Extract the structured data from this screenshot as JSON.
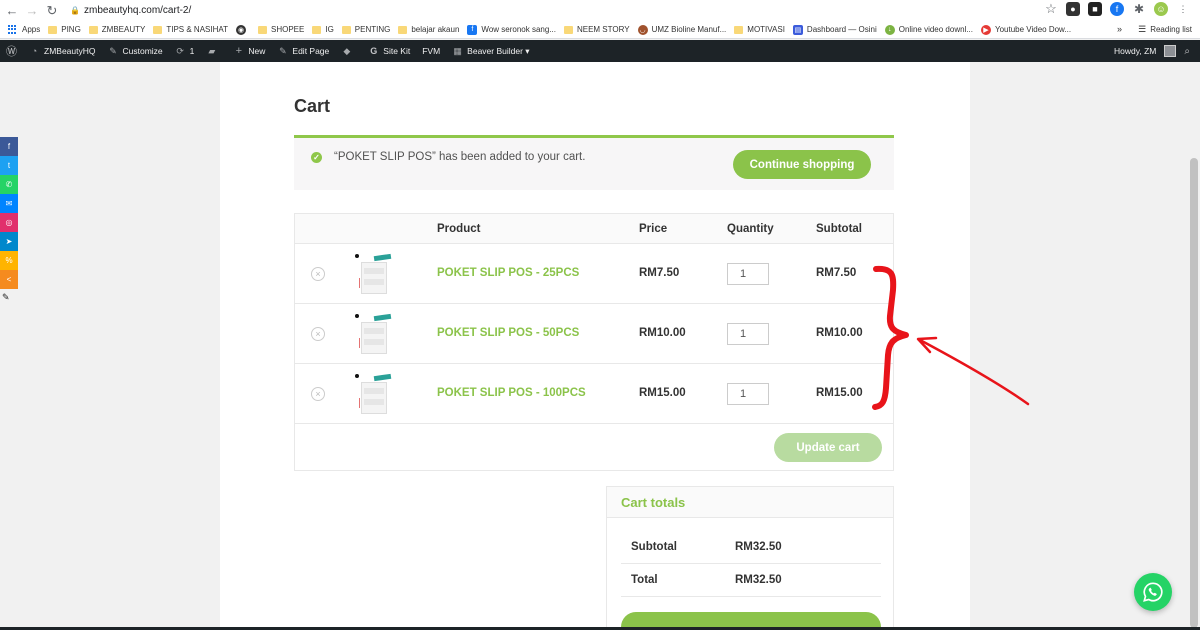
{
  "browser": {
    "url": "zmbeautyhq.com/cart-2/",
    "bookmarks": [
      {
        "label": "Apps",
        "kind": "apps"
      },
      {
        "label": "PING",
        "kind": "folder"
      },
      {
        "label": "ZMBEAUTY",
        "kind": "folder"
      },
      {
        "label": "TIPS & NASIHAT",
        "kind": "folder"
      },
      {
        "label": "",
        "kind": "globe"
      },
      {
        "label": "SHOPEE",
        "kind": "folder"
      },
      {
        "label": "IG",
        "kind": "folder"
      },
      {
        "label": "PENTING",
        "kind": "folder"
      },
      {
        "label": "belajar akaun",
        "kind": "folder"
      },
      {
        "label": "Wow seronok sang...",
        "kind": "facebook"
      },
      {
        "label": "NEEM STORY",
        "kind": "folder"
      },
      {
        "label": "UMZ Bioline Manuf...",
        "kind": "site"
      },
      {
        "label": "MOTIVASI",
        "kind": "folder"
      },
      {
        "label": "Dashboard — Osini",
        "kind": "dash"
      },
      {
        "label": "Online video downl...",
        "kind": "down"
      },
      {
        "label": "Youtube Video Dow...",
        "kind": "yt"
      }
    ],
    "more": "»",
    "reading_list": "Reading list"
  },
  "adminbar": {
    "site": "ZMBeautyHQ",
    "customize": "Customize",
    "updates": "1",
    "new": "New",
    "edit_page": "Edit Page",
    "site_kit": "Site Kit",
    "fvm": "FVM",
    "beaver": "Beaver Builder ▾",
    "howdy": "Howdy, ZM"
  },
  "page": {
    "title": "Cart",
    "notice": "“POKET SLIP POS” has been added to your cart.",
    "continue_label": "Continue shopping",
    "headers": {
      "product": "Product",
      "price": "Price",
      "quantity": "Quantity",
      "subtotal": "Subtotal"
    },
    "items": [
      {
        "name": "POKET SLIP POS - 25PCS",
        "price": "RM7.50",
        "qty": "1",
        "subtotal": "RM7.50"
      },
      {
        "name": "POKET SLIP POS - 50PCS",
        "price": "RM10.00",
        "qty": "1",
        "subtotal": "RM10.00"
      },
      {
        "name": "POKET SLIP POS - 100PCS",
        "price": "RM15.00",
        "qty": "1",
        "subtotal": "RM15.00"
      }
    ],
    "update_label": "Update cart",
    "totals": {
      "title": "Cart totals",
      "subtotal_label": "Subtotal",
      "subtotal_value": "RM32.50",
      "total_label": "Total",
      "total_value": "RM32.50"
    }
  },
  "colors": {
    "accent": "#8bc34a",
    "adminbar": "#1d2327",
    "annotation": "#e8141a",
    "whatsapp": "#25d366"
  }
}
